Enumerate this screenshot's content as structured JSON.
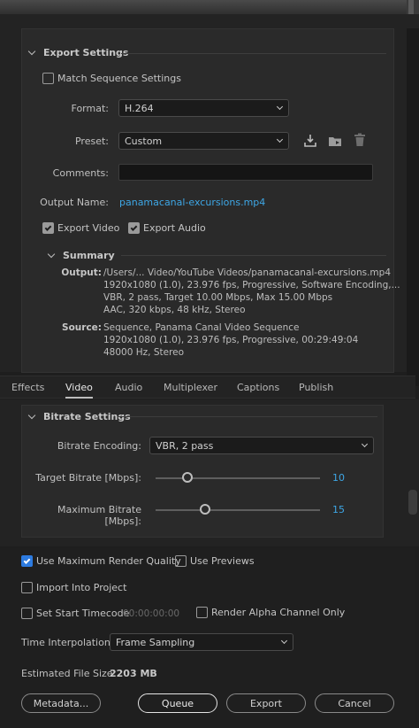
{
  "export_settings": {
    "heading": "Export Settings",
    "match_sequence_label": "Match Sequence Settings",
    "format_label": "Format:",
    "format_value": "H.264",
    "preset_label": "Preset:",
    "preset_value": "Custom",
    "comments_label": "Comments:",
    "comments_value": "",
    "output_name_label": "Output Name:",
    "output_name_value": "panamacanal-excursions.mp4",
    "export_video_label": "Export Video",
    "export_audio_label": "Export Audio"
  },
  "summary": {
    "heading": "Summary",
    "output_key": "Output:",
    "output_lines": [
      "/Users/... Video/YouTube Videos/panamacanal-excursions.mp4",
      "1920x1080 (1.0), 23.976 fps, Progressive, Software Encoding,...",
      "VBR, 2 pass, Target 10.00 Mbps, Max 15.00 Mbps",
      "AAC, 320 kbps, 48 kHz, Stereo"
    ],
    "source_key": "Source:",
    "source_lines": [
      "Sequence, Panama Canal Video Sequence",
      "1920x1080 (1.0), 23.976 fps, Progressive, 00:29:49:04",
      "48000 Hz, Stereo"
    ]
  },
  "tabs": [
    "Effects",
    "Video",
    "Audio",
    "Multiplexer",
    "Captions",
    "Publish"
  ],
  "bitrate": {
    "heading": "Bitrate Settings",
    "encoding_label": "Bitrate Encoding:",
    "encoding_value": "VBR, 2 pass",
    "target_label": "Target Bitrate [Mbps]:",
    "target_value": "10",
    "max_label": "Maximum Bitrate [Mbps]:",
    "max_value": "15"
  },
  "bottom": {
    "max_render_quality_label": "Use Maximum Render Quality",
    "use_previews_label": "Use Previews",
    "import_into_project_label": "Import Into Project",
    "set_start_timecode_label": "Set Start Timecode",
    "start_timecode_value": "00:00:00:00",
    "render_alpha_label": "Render Alpha Channel Only",
    "time_interp_label": "Time Interpolation:",
    "time_interp_value": "Frame Sampling",
    "est_size_label": "Estimated File Size:",
    "est_size_value": "2203 MB"
  },
  "buttons": {
    "metadata": "Metadata...",
    "queue": "Queue",
    "export": "Export",
    "cancel": "Cancel"
  },
  "colors": {
    "accent_link": "#3ea7e6",
    "checkbox_blue": "#2d7be0"
  }
}
